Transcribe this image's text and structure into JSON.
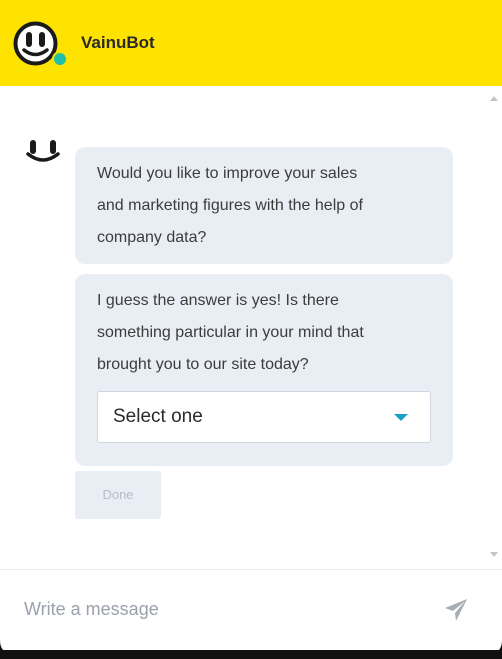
{
  "header": {
    "bot_name": "VainuBot",
    "avatar_icon": "vainu-face-icon",
    "status": "online",
    "colors": {
      "header_bg": "#ffe300",
      "online": "#1fbfa8"
    }
  },
  "conversation": {
    "messages": [
      {
        "sender": "bot",
        "lines": [
          "Would you like to improve your sales",
          "and marketing figures with the help of",
          "company data?"
        ]
      },
      {
        "sender": "bot",
        "lines": [
          "I guess the answer is yes! Is there",
          "something particular in your mind that",
          "brought you to our site today?"
        ]
      }
    ],
    "select": {
      "value": "Select one",
      "arrow_icon": "caret-down-icon"
    },
    "done_button": "Done"
  },
  "composer": {
    "placeholder": "Write a message",
    "send_icon": "send-icon"
  }
}
